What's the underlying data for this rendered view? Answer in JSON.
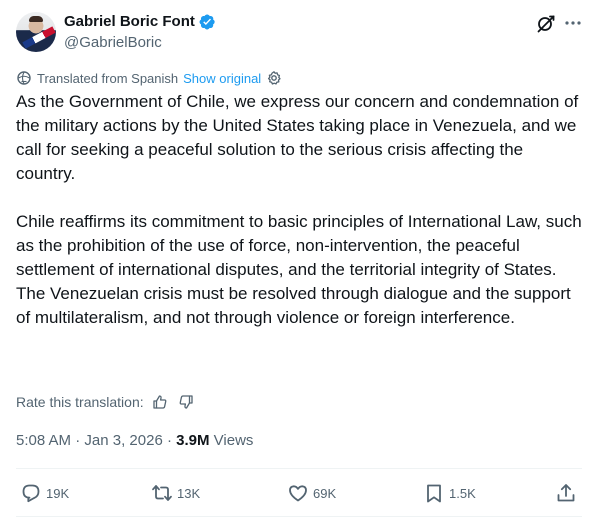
{
  "author": {
    "display_name": "Gabriel Boric Font",
    "handle": "@GabrielBoric",
    "verified_icon": "verified-badge-icon",
    "verified_color": "#1d9bf0"
  },
  "header_actions": {
    "grok_icon": "grok-icon",
    "more_icon": "more-options-icon"
  },
  "translation": {
    "label": "Translated from Spanish",
    "show_original": "Show original",
    "link_color": "#1d9bf0"
  },
  "tweet": {
    "paragraph_1": "As the Government of Chile, we express our concern and condemnation of the military actions by the United States taking place in Venezuela, and we call for seeking a peaceful solution to the serious crisis affecting the country.",
    "paragraph_2": "Chile reaffirms its commitment to basic principles of International Law, such as the prohibition of the use of force, non-intervention, the peaceful settlement of international disputes, and the territorial integrity of States.",
    "paragraph_3": "The Venezuelan crisis must be resolved through dialogue and the support of multilateralism, and not through violence or foreign interference."
  },
  "rate": {
    "label": "Rate this translation:"
  },
  "meta": {
    "time": "5:08 AM",
    "separator": " · ",
    "date": "Jan 3, 2026",
    "views_count": "3.9M",
    "views_label": " Views"
  },
  "actions": {
    "replies": "19K",
    "reposts": "13K",
    "likes": "69K",
    "bookmarks": "1.5K"
  }
}
